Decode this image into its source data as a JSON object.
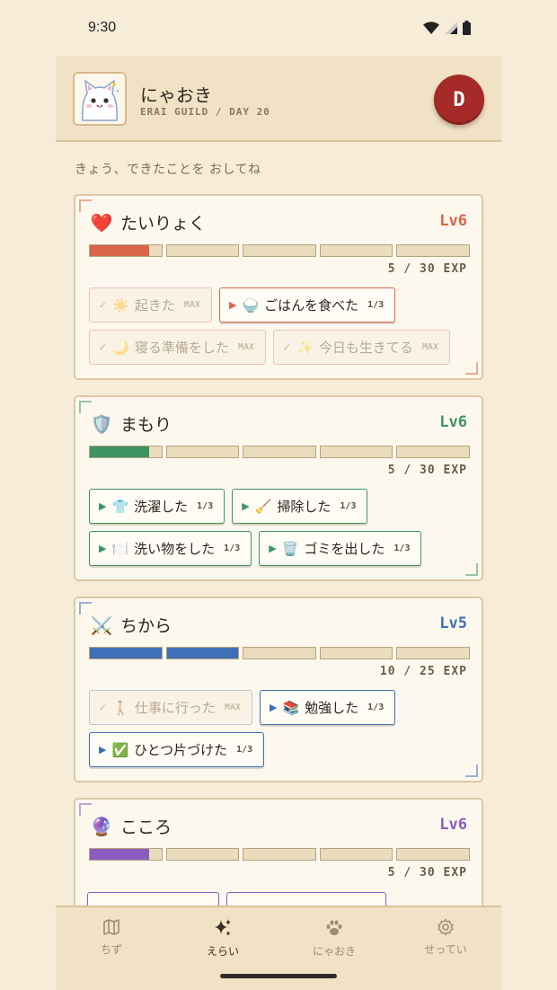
{
  "status_bar": {
    "time": "9:30"
  },
  "header": {
    "name": "にゃおき",
    "subtitle": "ERAI GUILD / DAY 20",
    "profile_button_label": "D"
  },
  "prompt": "きょう、できたことを おしてね",
  "colors": {
    "background": "#f6ecd8",
    "tairyoku": "#d9654a",
    "mamori": "#3d9460",
    "chikara": "#3f6fb4",
    "kokoro": "#8a5cc0",
    "profile_button": "#a52a28"
  },
  "cards": [
    {
      "icon": "❤️",
      "title": "たいりょく",
      "level": "Lv6",
      "exp_text": "5 / 30 EXP",
      "progress": 0.1667,
      "rows": [
        [
          {
            "marker": "✓",
            "icon": "☀️",
            "label": "起きた",
            "count": "MAX",
            "done": true
          },
          {
            "marker": "▶",
            "icon": "🍚",
            "label": "ごはんを食べた",
            "count": "1/3",
            "done": false
          }
        ],
        [
          {
            "marker": "✓",
            "icon": "🌙",
            "label": "寝る準備をした",
            "count": "MAX",
            "done": true
          },
          {
            "marker": "✓",
            "icon": "✨",
            "label": "今日も生きてる",
            "count": "MAX",
            "done": true
          }
        ]
      ]
    },
    {
      "icon": "🛡️",
      "title": "まもり",
      "level": "Lv6",
      "exp_text": "5 / 30 EXP",
      "progress": 0.1667,
      "rows": [
        [
          {
            "marker": "▶",
            "icon": "👕",
            "label": "洗濯した",
            "count": "1/3",
            "done": false
          },
          {
            "marker": "▶",
            "icon": "🧹",
            "label": "掃除した",
            "count": "1/3",
            "done": false
          }
        ],
        [
          {
            "marker": "▶",
            "icon": "🍽️",
            "label": "洗い物をした",
            "count": "1/3",
            "done": false
          },
          {
            "marker": "▶",
            "icon": "🗑️",
            "label": "ゴミを出した",
            "count": "1/3",
            "done": false
          }
        ]
      ]
    },
    {
      "icon": "⚔️",
      "title": "ちから",
      "level": "Lv5",
      "exp_text": "10 / 25 EXP",
      "progress": 0.4,
      "rows": [
        [
          {
            "marker": "✓",
            "icon": "🚶",
            "label": "仕事に行った",
            "count": "MAX",
            "done": true
          },
          {
            "marker": "▶",
            "icon": "📚",
            "label": "勉強した",
            "count": "1/3",
            "done": false
          }
        ],
        [
          {
            "marker": "▶",
            "icon": "✅",
            "label": "ひとつ片づけた",
            "count": "1/3",
            "done": false
          }
        ]
      ]
    },
    {
      "icon": "🔮",
      "title": "こころ",
      "level": "Lv6",
      "exp_text": "5 / 30 EXP",
      "progress": 0.1667,
      "rows": []
    }
  ],
  "nav": [
    {
      "icon": "map-icon",
      "label": "ちず",
      "active": false
    },
    {
      "icon": "sparkles-icon",
      "label": "えらい",
      "active": true
    },
    {
      "icon": "paw-icon",
      "label": "にゃおき",
      "active": false
    },
    {
      "icon": "gear-icon",
      "label": "せってい",
      "active": false
    }
  ]
}
